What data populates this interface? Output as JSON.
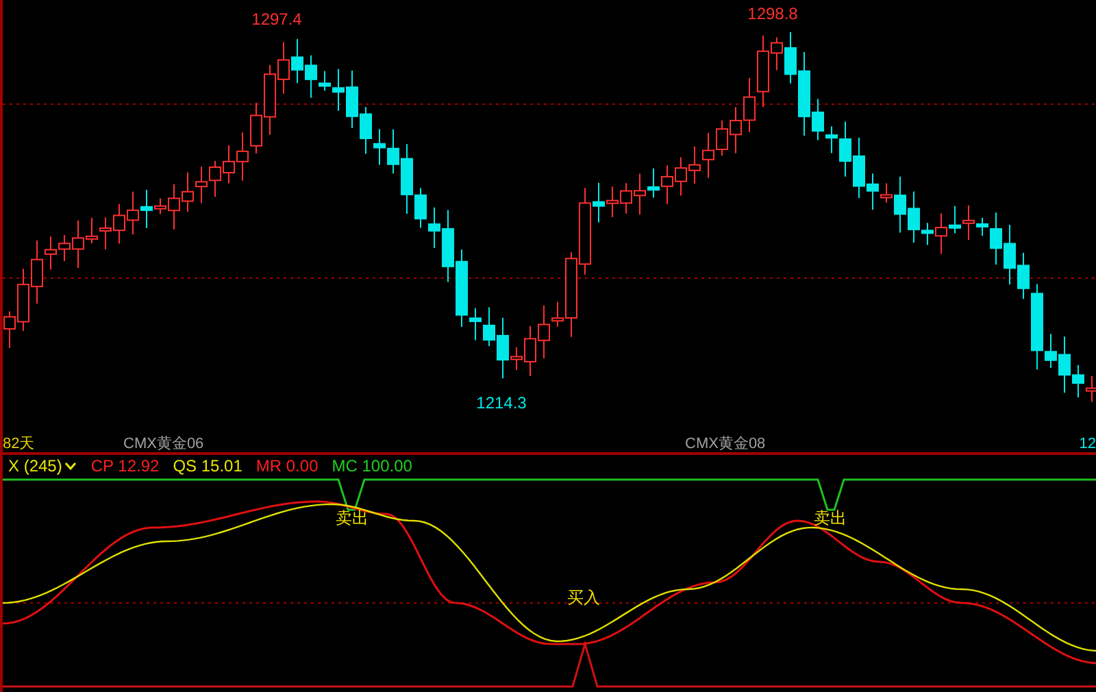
{
  "price_chart": {
    "price_labels": [
      {
        "text": "1297.4",
        "kind": "high"
      },
      {
        "text": "1298.8",
        "kind": "high"
      },
      {
        "text": "1214.3",
        "kind": "low"
      }
    ]
  },
  "time_axis": {
    "labels": [
      {
        "text": "82天",
        "kind": "period"
      },
      {
        "text": "CMX黄金06",
        "kind": "contract"
      },
      {
        "text": "CMX黄金08",
        "kind": "contract"
      },
      {
        "text": "12",
        "kind": "price"
      }
    ]
  },
  "indicator": {
    "name": "X (245)",
    "legend": [
      {
        "text": "CP 12.92",
        "color": "#ff2020"
      },
      {
        "text": "QS 15.01",
        "color": "#e8e800"
      },
      {
        "text": "MR 0.00",
        "color": "#ff2020"
      },
      {
        "text": "MC 100.00",
        "color": "#20d020"
      }
    ],
    "signals": [
      {
        "text": "卖出"
      },
      {
        "text": "卖出"
      },
      {
        "text": "买入"
      }
    ]
  }
}
